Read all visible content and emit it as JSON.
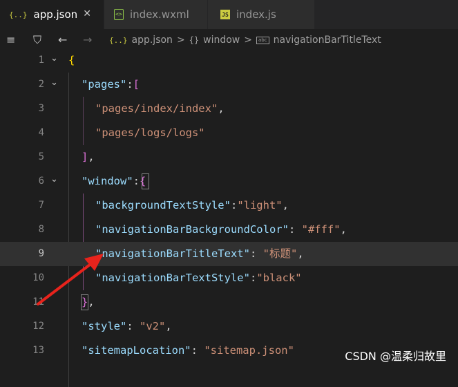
{
  "tabs": [
    {
      "icon": "{..}",
      "label": "app.json",
      "close": "✕"
    },
    {
      "icon": "<>",
      "label": "index.wxml"
    },
    {
      "icon": "JS",
      "label": "index.js"
    }
  ],
  "toolbar": {
    "list_icon": "≡",
    "bookmark_icon": "⛉",
    "back_icon": "←",
    "forward_icon": "→"
  },
  "breadcrumb": {
    "file_icon": "{..}",
    "file": "app.json",
    "sep": ">",
    "obj_icon": "{}",
    "obj": "window",
    "prop_icon": "abc",
    "prop": "navigationBarTitleText"
  },
  "code": {
    "line_numbers": [
      "1",
      "2",
      "3",
      "4",
      "5",
      "6",
      "7",
      "8",
      "9",
      "10",
      "11",
      "12",
      "13"
    ],
    "active_line": "9",
    "l1_brace": "{",
    "l2_key": "\"pages\"",
    "l2_colon": ":",
    "l2_bracket": "[",
    "l3_str": "\"pages/index/index\"",
    "l3_comma": ",",
    "l4_str": "\"pages/logs/logs\"",
    "l5_bracket": "]",
    "l5_comma": ",",
    "l6_key": "\"window\"",
    "l6_colon": ":",
    "l6_brace": "{",
    "l7_key": "\"backgroundTextStyle\"",
    "l7_colon": ":",
    "l7_val": "\"light\"",
    "l7_comma": ",",
    "l8_key": "\"navigationBarBackgroundColor\"",
    "l8_colon": ": ",
    "l8_val": "\"#fff\"",
    "l8_comma": ",",
    "l9_key": "\"navigationBarTitleText\"",
    "l9_colon": ": ",
    "l9_val": "\"标题\"",
    "l9_comma": ",",
    "l10_key": "\"navigationBarTextStyle\"",
    "l10_colon": ":",
    "l10_val": "\"black\"",
    "l11_brace": "}",
    "l11_comma": ",",
    "l12_key": "\"style\"",
    "l12_colon": ": ",
    "l12_val": "\"v2\"",
    "l12_comma": ",",
    "l13_key": "\"sitemapLocation\"",
    "l13_colon": ": ",
    "l13_val": "\"sitemap.json\""
  },
  "watermark": "CSDN @温柔归故里",
  "colors": {
    "background": "#1e1e1e",
    "key": "#9cdcfe",
    "string": "#ce9178",
    "arrow": "#e8231c"
  }
}
